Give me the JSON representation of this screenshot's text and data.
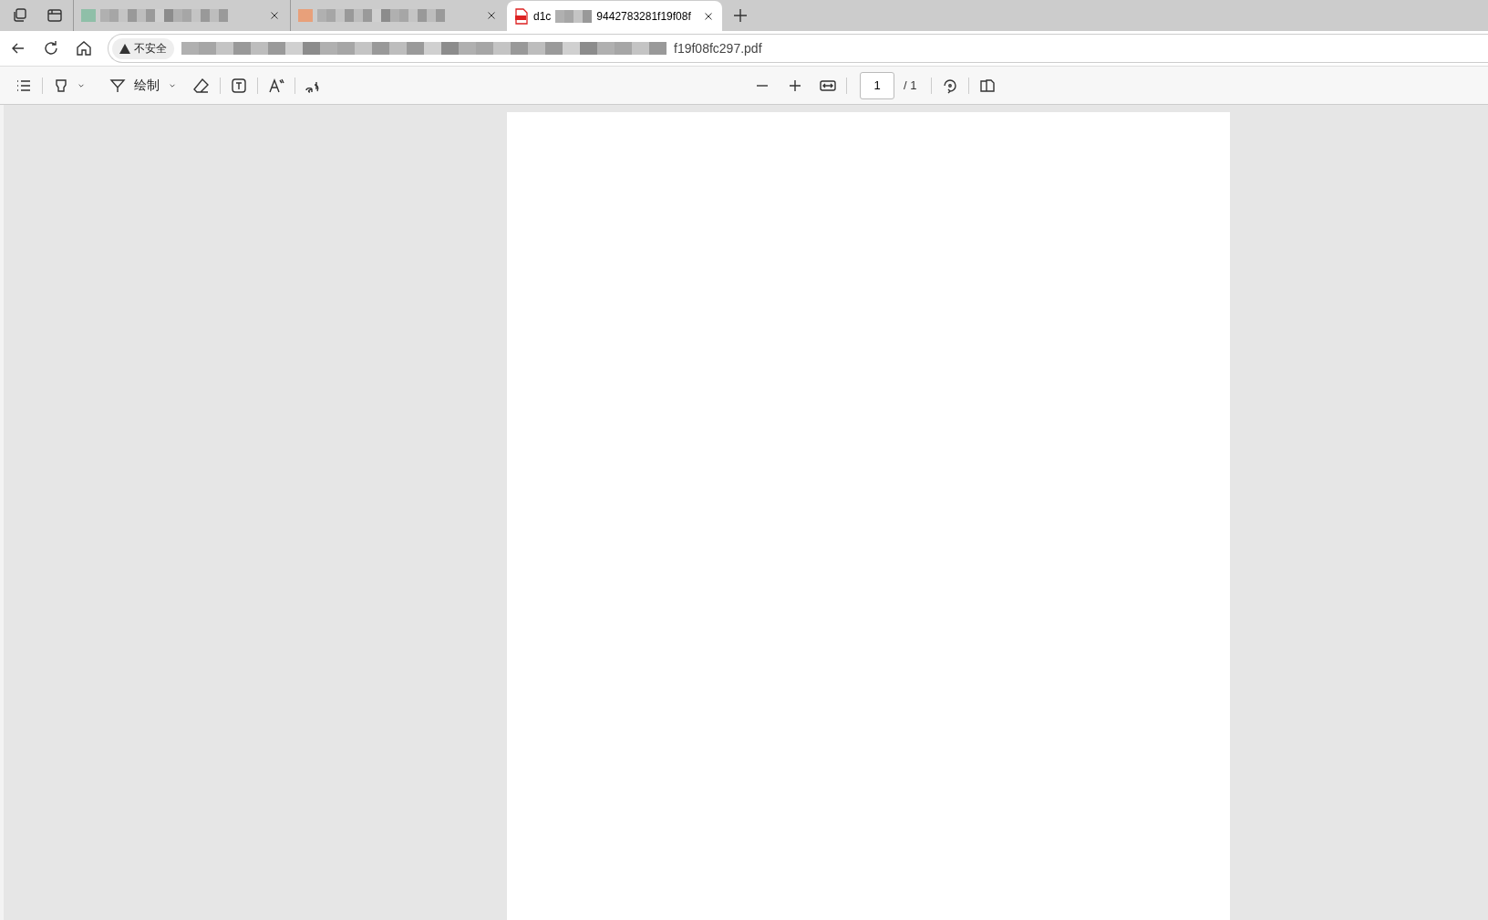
{
  "tabs": [
    {
      "kind": "blurred",
      "selected": false,
      "color": "#8fbfa8"
    },
    {
      "kind": "blurred",
      "selected": false,
      "color": "#e8a07a"
    },
    {
      "kind": "pdf",
      "selected": true,
      "title_start": "d1c",
      "title_end": "9442783281f19f08f"
    }
  ],
  "address": {
    "security": "不安全",
    "url_end": "f19f08fc297.pdf"
  },
  "toolbar": {
    "draw_label": "绘制",
    "page_value": "1",
    "page_total": "/ 1"
  }
}
